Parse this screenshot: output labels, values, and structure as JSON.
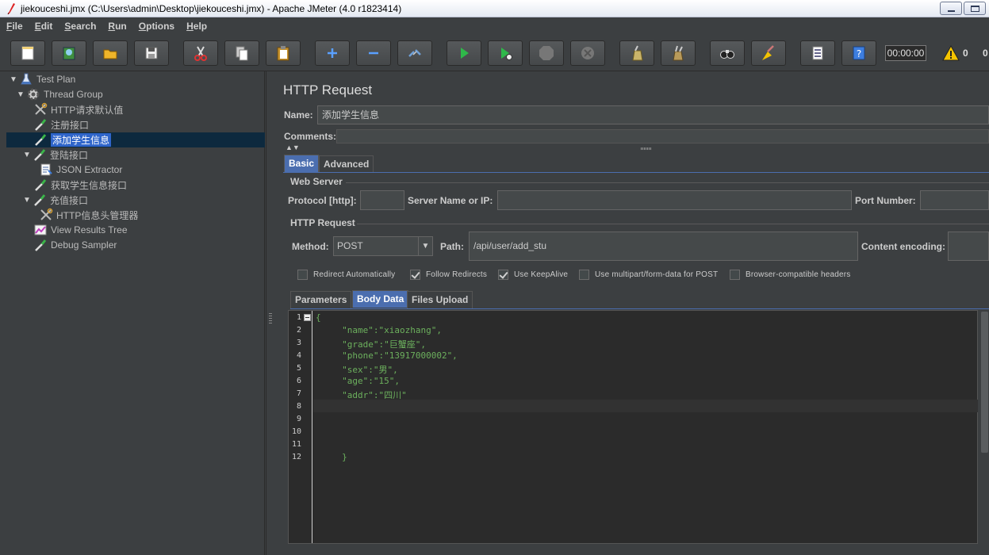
{
  "window": {
    "title": "jiekouceshi.jmx (C:\\Users\\admin\\Desktop\\jiekouceshi.jmx) - Apache JMeter (4.0 r1823414)"
  },
  "menu": [
    "File",
    "Edit",
    "Search",
    "Run",
    "Options",
    "Help"
  ],
  "toolbar": {
    "buttons": [
      "new-icon",
      "templates-icon",
      "open-icon",
      "save-icon",
      "cut-icon",
      "copy-icon",
      "paste-icon",
      "expand-icon",
      "collapse-icon",
      "toggle-icon",
      "start-icon",
      "start-no-timers-icon",
      "stop-icon",
      "shutdown-icon",
      "clear-icon",
      "clear-all-icon",
      "search-icon",
      "reset-search-icon",
      "function-helper-icon",
      "help-icon"
    ],
    "timer": "00:00:00",
    "warning_count": "0",
    "thread_count": "0"
  },
  "tree": {
    "nodes": [
      {
        "label": "Test Plan"
      },
      {
        "label": "Thread Group"
      },
      {
        "label": "HTTP请求默认值"
      },
      {
        "label": "注册接口"
      },
      {
        "label": "添加学生信息"
      },
      {
        "label": "登陆接口"
      },
      {
        "label": "JSON Extractor"
      },
      {
        "label": "获取学生信息接口"
      },
      {
        "label": "充值接口"
      },
      {
        "label": "HTTP信息头管理器"
      },
      {
        "label": "View Results Tree"
      },
      {
        "label": "Debug Sampler"
      }
    ]
  },
  "panel": {
    "title": "HTTP Request",
    "name_label": "Name:",
    "name_value": "添加学生信息",
    "comments_label": "Comments:",
    "tabs": [
      "Basic",
      "Advanced"
    ],
    "web_server": {
      "title": "Web Server",
      "protocol_label": "Protocol [http]:",
      "protocol_value": "",
      "server_label": "Server Name or IP:",
      "server_value": "",
      "port_label": "Port Number:",
      "port_value": ""
    },
    "http_request": {
      "title": "HTTP Request",
      "method_label": "Method:",
      "method_value": "POST",
      "path_label": "Path:",
      "path_value": "/api/user/add_stu",
      "encoding_label": "Content encoding:",
      "encoding_value": ""
    },
    "checkboxes": [
      {
        "label": "Redirect Automatically",
        "checked": false
      },
      {
        "label": "Follow Redirects",
        "checked": true
      },
      {
        "label": "Use KeepAlive",
        "checked": true
      },
      {
        "label": "Use multipart/form-data for POST",
        "checked": false
      },
      {
        "label": "Browser-compatible headers",
        "checked": false
      }
    ],
    "subtabs": [
      "Parameters",
      "Body Data",
      "Files Upload"
    ],
    "editor": {
      "line_numbers": [
        "1",
        "2",
        "3",
        "4",
        "5",
        "6",
        "7",
        "8",
        "9",
        "10",
        "11",
        "12"
      ],
      "lines": [
        "{",
        "     \"name\":\"xiaozhang\",",
        "     \"grade\":\"巨蟹座\",",
        "     \"phone\":\"13917000002\",",
        "     \"sex\":\"男\",",
        "     \"age\":\"15\",",
        "     \"addr\":\"四川\"",
        "",
        "",
        "",
        "",
        "     }"
      ]
    }
  }
}
